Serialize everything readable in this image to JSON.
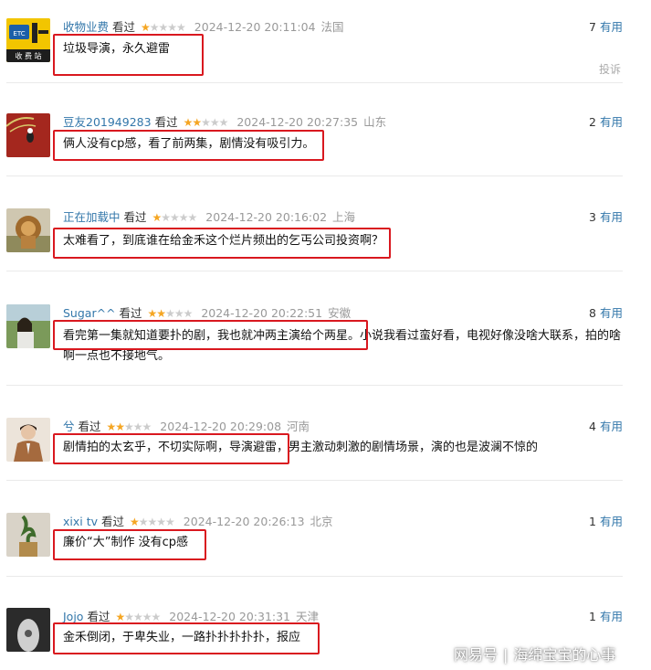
{
  "reviews": [
    {
      "user": "收物业费",
      "watched": "看过",
      "stars": 1,
      "time": "2024-12-20 20:11:04",
      "location": "法国",
      "votes": "7",
      "useful": "有用",
      "comment": "垃圾导演，永久避雷",
      "extra": "",
      "avatar_text": [
        "ETC",
        "收 费 站"
      ]
    },
    {
      "user": "豆友201949283",
      "watched": "看过",
      "stars": 2,
      "time": "2024-12-20 20:27:35",
      "location": "山东",
      "votes": "2",
      "useful": "有用",
      "comment": "俩人没有cp感，看了前两集，剧情没有吸引力。",
      "extra": ""
    },
    {
      "user": "正在加载中",
      "watched": "看过",
      "stars": 1,
      "time": "2024-12-20 20:16:02",
      "location": "上海",
      "votes": "3",
      "useful": "有用",
      "comment": "太难看了，到底谁在给金禾这个烂片频出的乞丐公司投资啊？",
      "extra": ""
    },
    {
      "user": "Sugar^^",
      "watched": "看过",
      "stars": 2,
      "time": "2024-12-20 20:22:51",
      "location": "安徽",
      "votes": "8",
      "useful": "有用",
      "comment": "看完第一集就知道要扑的剧，我也就冲两主演给个两星。",
      "extra": "小说我看过蛮好看，电视好像没啥大联系，拍的啥",
      "line2": "啊一点也不接地气。"
    },
    {
      "user": "兮",
      "watched": "看过",
      "stars": 2,
      "time": "2024-12-20 20:29:08",
      "location": "河南",
      "votes": "4",
      "useful": "有用",
      "comment": "剧情拍的太玄乎，不切实际啊，导演避雷，",
      "extra": "男主激动刺激的剧情场景，演的也是波澜不惊的"
    },
    {
      "user": "xixi tv",
      "watched": "看过",
      "stars": 1,
      "time": "2024-12-20 20:26:13",
      "location": "北京",
      "votes": "1",
      "useful": "有用",
      "comment": "廉价“大”制作 没有cp感",
      "extra": ""
    },
    {
      "user": "Jojo",
      "watched": "看过",
      "stars": 1,
      "time": "2024-12-20 20:31:31",
      "location": "天津",
      "votes": "1",
      "useful": "有用",
      "comment": "金禾倒闭，于卑失业，一路扑扑扑扑扑，报应",
      "extra": ""
    }
  ],
  "report_label": "投诉",
  "watermark": {
    "brand": "网易号",
    "sep": "|",
    "author": "海绵宝宝的心事"
  },
  "colors": {
    "highlight": "#d9181f",
    "link": "#3377aa",
    "star": "#f5a623"
  }
}
